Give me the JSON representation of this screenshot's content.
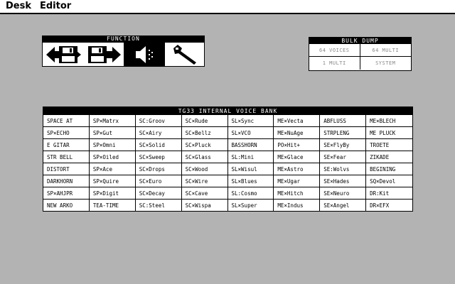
{
  "menubar": {
    "desk": "Desk",
    "editor": "Editor"
  },
  "function_panel": {
    "title": "FUNCTION",
    "buttons": [
      {
        "name": "load-from-disk",
        "icon": "floppy-disk-load-icon"
      },
      {
        "name": "save-to-disk",
        "icon": "floppy-disk-save-icon"
      },
      {
        "name": "audition",
        "icon": "speaker-icon",
        "selected": true
      },
      {
        "name": "edit",
        "icon": "wrench-icon"
      }
    ]
  },
  "bulk_dump": {
    "title": "BULK DUMP",
    "cells": [
      "64 VOICES",
      "64 MULTI",
      "1 MULTI",
      "SYSTEM"
    ]
  },
  "voice_bank": {
    "title": "TG33 INTERNAL VOICE BANK",
    "voices": [
      "SPACE AT",
      "SP×Matrx",
      "SC:Groov",
      "SC×Rude",
      "SL×Sync",
      "ME×Vecta",
      "ABFLUSS",
      "ME×BLECH",
      "SP×ECHO",
      "SP×Gut",
      "SC×Airy",
      "SC×Bellz",
      "SL×VCO",
      "ME×NuAge",
      "STRPLENG",
      "ME PLUCK",
      "E GITAR",
      "SP×Omni",
      "SC×Solid",
      "SC×Pluck",
      "BASSHORN",
      "PO×Hit+",
      "SE×FlyBy",
      "TROETE",
      "STR BELL",
      "SP×Oiled",
      "SC×Sweep",
      "SC×Glass",
      "SL:Mini",
      "ME×Glace",
      "SE×Fear",
      "ZIKADE",
      "DISTORT",
      "SP×Ace",
      "SC×Drops",
      "SC×Wood",
      "SL×Wisul",
      "ME×Astro",
      "SE:Wolvs",
      "BEGINING",
      "DARKHORN",
      "SP×Quire",
      "SC×Euro",
      "SC×Wire",
      "SL×Blues",
      "ME×Ugar",
      "SE×Hades",
      "SQ×Devol",
      "SP×AHJPR",
      "SP×Digit",
      "SC×Decay",
      "SC×Cave",
      "SL:Cosmo",
      "ME×Hitch",
      "SE×Neuro",
      "DR:Kit",
      "NEW ARKO",
      "TEA-TIME",
      "SC:Steel",
      "SC×Wispa",
      "SL×Super",
      "ME×Indus",
      "SE×Angel",
      "DR×EFX"
    ]
  }
}
